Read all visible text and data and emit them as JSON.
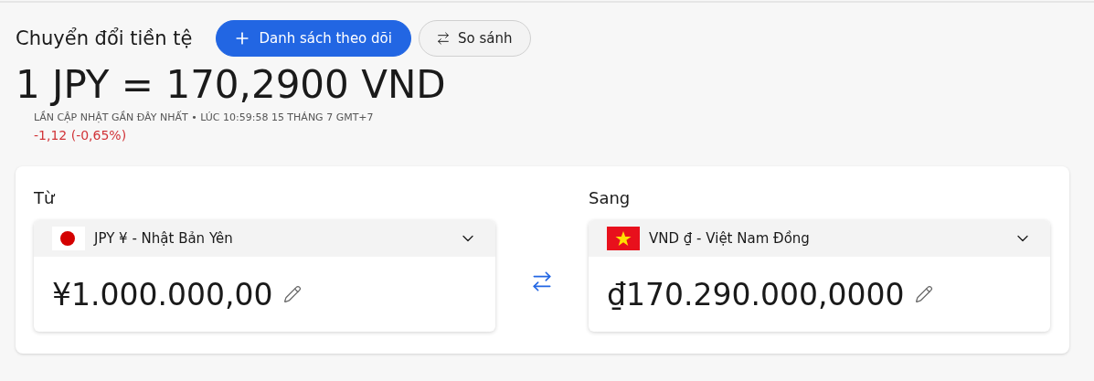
{
  "header": {
    "title": "Chuyển đổi tiền tệ",
    "buttons": [
      {
        "kind": "primary",
        "label": "Danh sách theo dõi"
      },
      {
        "kind": "secondary",
        "label": "So sánh"
      }
    ]
  },
  "rate": {
    "text": "1 JPY = 170,2900 VND",
    "updated": "LẦN CẬP NHẬT GẦN ĐÂY NHẤT • LÚC 10:59:58 15 THÁNG 7 GMT+7",
    "change": "-1,12 (-0,65%)"
  },
  "converter": [
    {
      "label": "Từ",
      "currency": "JPY ¥ - Nhật Bản Yên",
      "amount": "¥1.000.000,00"
    },
    {
      "label": "Sang",
      "currency": "VND ₫ - Việt Nam Đồng",
      "amount": "₫170.290.000,0000"
    }
  ]
}
